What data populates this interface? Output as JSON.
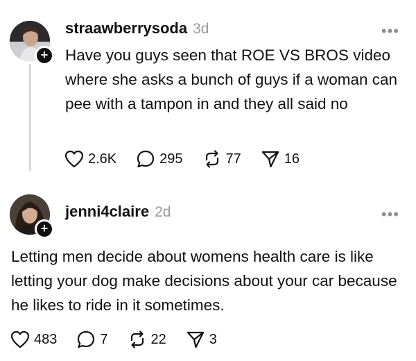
{
  "posts": [
    {
      "username": "straawberrysoda",
      "time": "3d",
      "more": "•••",
      "text": "Have you guys seen that ROE VS BROS video where she asks a bunch of guys if a woman can pee with a tampon in and they all said no",
      "likes": "2.6K",
      "replies": "295",
      "reposts": "77",
      "shares": "16"
    },
    {
      "username": "jenni4claire",
      "time": "2d",
      "more": "•••",
      "text": "Letting men decide about womens health care is like letting your dog make decisions about your car because he likes to ride in it sometimes.",
      "likes": "483",
      "replies": "7",
      "reposts": "22",
      "shares": "3"
    }
  ],
  "icons": {
    "follow_badge": "+",
    "like": "heart-icon",
    "reply": "comment-icon",
    "repost": "repost-icon",
    "share": "share-icon"
  }
}
